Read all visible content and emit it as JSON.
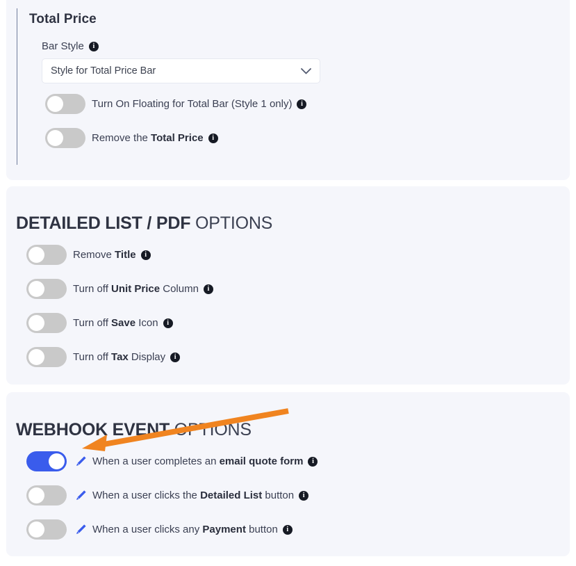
{
  "colors": {
    "panel_bg": "#f5f6fb",
    "page_bg": "#ffffff",
    "toggle_on": "#3a5cec",
    "toggle_off": "#c9c9c9",
    "accent_line": "#6f7c9b",
    "pencil": "#3a5cec",
    "arrow": "#f08420",
    "text": "#3a3f52"
  },
  "total_price": {
    "title": "Total Price",
    "bar_style": {
      "label": "Bar Style",
      "info_glyph": "i",
      "selected": "Style for Total Price Bar",
      "caret_icon": "chevron-down-icon"
    },
    "toggles": [
      {
        "state": "off",
        "parts": [
          {
            "text": "Turn On Floating for Total Bar (Style 1 only)",
            "bold": false
          }
        ],
        "info_glyph": "i"
      },
      {
        "state": "off",
        "parts": [
          {
            "text": "Remove the ",
            "bold": false
          },
          {
            "text": "Total Price",
            "bold": true
          }
        ],
        "info_glyph": "i"
      }
    ]
  },
  "detailed_list": {
    "heading_strong": "DETAILED LIST / PDF",
    "heading_light": " OPTIONS",
    "toggles": [
      {
        "state": "off",
        "parts": [
          {
            "text": "Remove ",
            "bold": false
          },
          {
            "text": "Title",
            "bold": true
          }
        ],
        "info_glyph": "i"
      },
      {
        "state": "off",
        "parts": [
          {
            "text": "Turn off ",
            "bold": false
          },
          {
            "text": "Unit Price",
            "bold": true
          },
          {
            "text": " Column",
            "bold": false
          }
        ],
        "info_glyph": "i"
      },
      {
        "state": "off",
        "parts": [
          {
            "text": "Turn off ",
            "bold": false
          },
          {
            "text": "Save",
            "bold": true
          },
          {
            "text": " Icon",
            "bold": false
          }
        ],
        "info_glyph": "i"
      },
      {
        "state": "off",
        "parts": [
          {
            "text": "Turn off ",
            "bold": false
          },
          {
            "text": "Tax",
            "bold": true
          },
          {
            "text": " Display",
            "bold": false
          }
        ],
        "info_glyph": "i"
      }
    ]
  },
  "webhook": {
    "heading_strong": "WEBHOOK EVENT",
    "heading_light": " OPTIONS",
    "toggles": [
      {
        "state": "on",
        "edit_icon": "pencil-icon",
        "parts": [
          {
            "text": "When a user completes an ",
            "bold": false
          },
          {
            "text": "email quote form",
            "bold": true
          }
        ],
        "info_glyph": "i"
      },
      {
        "state": "off",
        "edit_icon": "pencil-icon",
        "parts": [
          {
            "text": "When a user clicks the ",
            "bold": false
          },
          {
            "text": "Detailed List",
            "bold": true
          },
          {
            "text": " button",
            "bold": false
          }
        ],
        "info_glyph": "i"
      },
      {
        "state": "off",
        "edit_icon": "pencil-icon",
        "parts": [
          {
            "text": "When a user clicks any ",
            "bold": false
          },
          {
            "text": "Payment",
            "bold": true
          },
          {
            "text": " button",
            "bold": false
          }
        ],
        "info_glyph": "i"
      }
    ]
  },
  "annotation": {
    "type": "arrow",
    "points_to": "webhook-toggle-0",
    "color": "#f08420"
  }
}
